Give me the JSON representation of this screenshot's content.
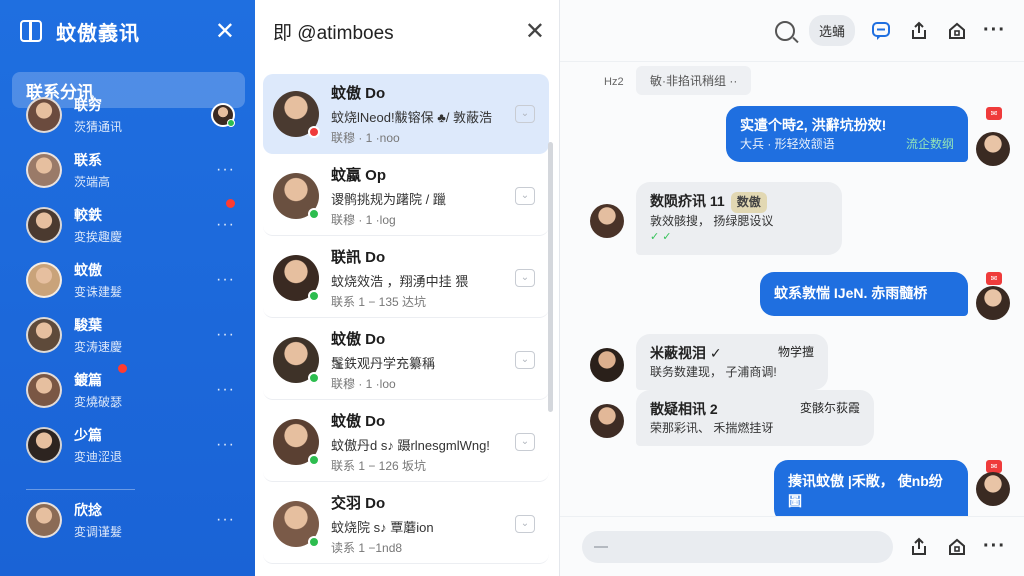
{
  "sidebar": {
    "title": "蚊傲義讯",
    "active_label": "联系分讯",
    "items": [
      {
        "name": "联穷",
        "sub": "茨猜通讯",
        "color": "#6b4b3e",
        "dot": false,
        "has_side_avatar": true
      },
      {
        "name": "联系",
        "sub": "茨端高",
        "color": "#9a7a68",
        "dot": false,
        "has_side_avatar": false
      },
      {
        "name": "較鉄",
        "sub": "変挨趣慶",
        "color": "#4b3a2f",
        "dot": true,
        "has_side_avatar": false
      },
      {
        "name": "蚊傲",
        "sub": "变诛建髮",
        "color": "#c9a37a",
        "dot": false,
        "has_side_avatar": false
      },
      {
        "name": "駿葉",
        "sub": "変涛速慶",
        "color": "#5e4a3a",
        "dot": false,
        "has_side_avatar": false
      },
      {
        "name": "鍍篇",
        "sub": "変燒破瑟",
        "color": "#7a5744",
        "dot": true,
        "has_side_avatar": false
      },
      {
        "name": "少篇",
        "sub": "変迪涩退",
        "color": "#2d2420",
        "dot": false,
        "has_side_avatar": false
      },
      {
        "name": "欣捻",
        "sub": "変调谨髮",
        "color": "#8b6b55",
        "dot": false,
        "has_side_avatar": false
      }
    ],
    "more_label": "···"
  },
  "conversations": {
    "title": "即 @atimboes",
    "items": [
      {
        "name": "蚊傲 Do",
        "preview": "蚊烧lNeod!黻镕保 ♣/ 敦蔽浩",
        "time": "联穆 · 1 ·noo",
        "color": "#4a3a30",
        "status": "red",
        "selected": true
      },
      {
        "name": "蚊蠃 Op",
        "preview": "谡鹘挑规为躇院 / 躐",
        "time": "联穆 · 1 ·log",
        "color": "#6a5040",
        "status": "green",
        "selected": false
      },
      {
        "name": "联訊 Do",
        "preview": "蚊烧效浩 ，翔湧中挂 猥",
        "time": "联系 1 − 135 达坑",
        "color": "#3a2a22",
        "status": "green",
        "selected": false
      },
      {
        "name": "蚊傲 Do",
        "preview": "鬔鉄观丹学充纂稱",
        "time": "联穆 · 1 ·loo",
        "color": "#3e3228",
        "status": "green",
        "selected": false
      },
      {
        "name": "蚊傲 Do",
        "preview": "蚊傲丹d s♪ 蹑rlnesgmlWng!",
        "time": "联系 1 − 126 坂坑",
        "color": "#5a4032",
        "status": "green",
        "selected": false
      },
      {
        "name": "交羽 Do",
        "preview": "蚊烧院 s♪ 覃蘑ion",
        "time": "读系 1 −1nd8",
        "color": "#7a5a48",
        "status": "green",
        "selected": false
      }
    ]
  },
  "chat": {
    "search_pill": "选蛹",
    "time_label": "Hz2",
    "system_message": "敏·非掐讯稍组 ··",
    "messages": [
      {
        "dir": "out",
        "line1": "实遣个時2, 洪辭坑扮效!",
        "line2": "大兵 · 形轻效颔语",
        "extra": "流企数纲"
      },
      {
        "dir": "in",
        "line1": "数陨疥讯 11",
        "tag": "数傲",
        "line2": "敦效骸搜， 扬绿腮设议",
        "tick": "✓ ✓"
      },
      {
        "dir": "out",
        "line1": "蚊系敦惴 IJeN. 赤雨髓桥",
        "line2": ""
      },
      {
        "dir": "in",
        "line1": "米蔽视泪 ✓",
        "tag2": "物学擅",
        "line2": "联务数建现， 子浦商调!"
      },
      {
        "dir": "in",
        "line1": "散疑相讯 2",
        "tag2": "変骸尓荻霞",
        "line2": "荣那彩讯、 禾揣燃挂讶"
      },
      {
        "dir": "out",
        "line1": "揍讯蚊傲 |禾敞， 使nb纷圖",
        "line2": ""
      }
    ],
    "input_placeholder": ""
  }
}
